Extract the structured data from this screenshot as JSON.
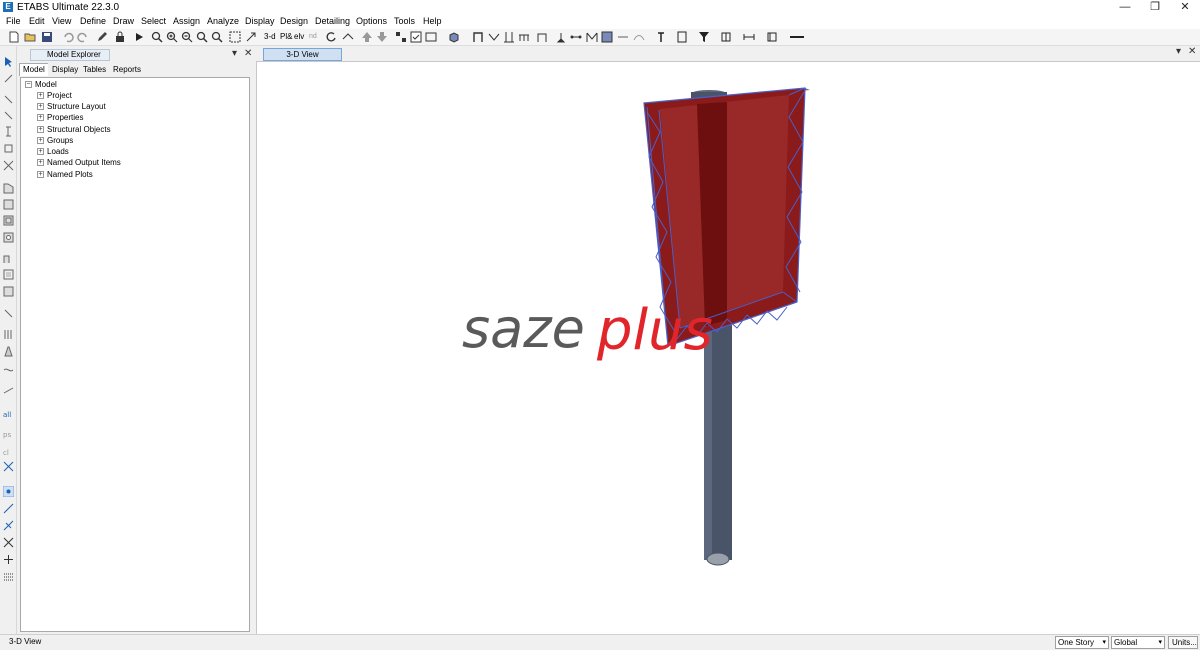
{
  "window": {
    "title": "ETABS Ultimate 22.3.0",
    "app_icon_letter": "E",
    "minimize": "—",
    "restore": "❐",
    "close": "✕"
  },
  "menu": [
    "File",
    "Edit",
    "View",
    "Define",
    "Draw",
    "Select",
    "Assign",
    "Analyze",
    "Display",
    "Design",
    "Detailing",
    "Options",
    "Tools",
    "Help"
  ],
  "toolbar": {
    "view_3d_label": "3-d",
    "plan_label": "Pl&",
    "elev_label": "elv",
    "nd_label": "nd"
  },
  "model_explorer": {
    "title": "Model Explorer",
    "pin": "▾",
    "close": "✕",
    "tabs": [
      "Model",
      "Display",
      "Tables",
      "Reports"
    ],
    "active_tab": "Model",
    "root": "Model",
    "items": [
      "Project",
      "Structure Layout",
      "Properties",
      "Structural Objects",
      "Groups",
      "Loads",
      "Named Output Items",
      "Named Plots"
    ]
  },
  "view": {
    "tab_label": "3-D View",
    "pin": "▾",
    "close": "✕",
    "watermark": {
      "part1": "saze",
      "part2": "plus"
    }
  },
  "status": {
    "left_text": "3-D View",
    "story_combo": "One Story",
    "coord_combo": "Global",
    "units_button": "Units..."
  },
  "colors": {
    "panel_fill": "#8b1a1a",
    "frame_blue": "#4a5fc8",
    "pole": "#4a5468",
    "watermark_gray": "#5a5a5a",
    "watermark_red": "#e0262a"
  }
}
